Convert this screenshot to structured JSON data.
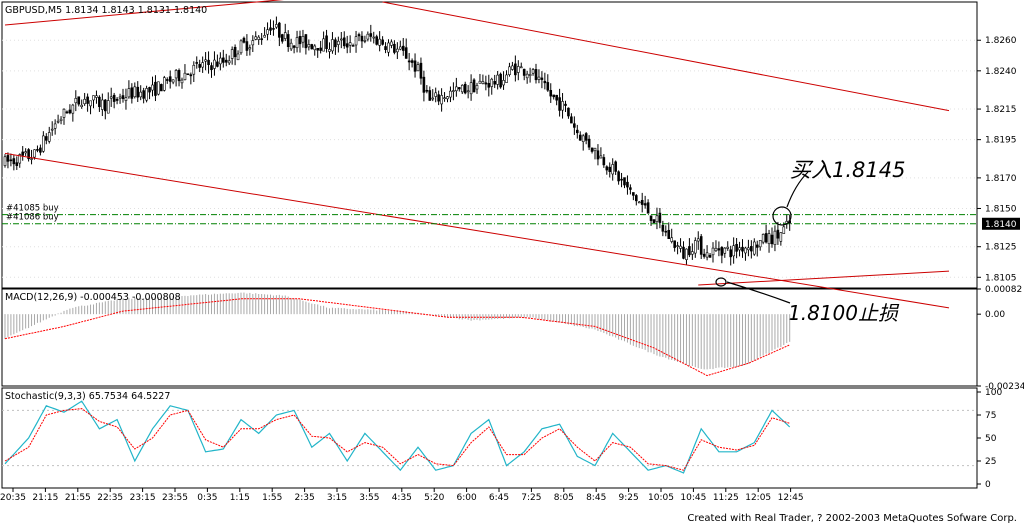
{
  "footer": "Created with Real Trader, ? 2002-2003 MetaQuotes Sofware Corp.",
  "colors": {
    "up_candle": "#ffffff",
    "down_candle": "#000000",
    "trendline": "#cc0000",
    "order_line": "#008000",
    "macd_hist": "#a9a9a9",
    "macd_signal": "#ff0000",
    "stoch_main": "#22b5c9",
    "stoch_signal": "#ff0000",
    "price_box": "#000000"
  },
  "price_pane": {
    "header": "GBPUSD,M5  1.8134 1.8143 1.8131 1.8140",
    "y_ticks": [
      "1.8260",
      "1.8240",
      "1.8215",
      "1.8195",
      "1.8170",
      "1.8150",
      "1.8125",
      "1.8105"
    ],
    "current_price": "1.8140",
    "orders": [
      "#41085 buy",
      "#41086 buy"
    ],
    "annotations": {
      "entry": "买入1.8145",
      "stop": "1.8100止损"
    }
  },
  "macd_pane": {
    "header": "MACD(12,26,9)  -0.000453  -0.000808",
    "y_ticks": [
      "0.00082",
      "0.00",
      "-0.00234"
    ]
  },
  "stoch_pane": {
    "header": "Stochastic(9,3,3)  65.7534  64.5227",
    "y_ticks": [
      "100",
      "75",
      "50",
      "25",
      "0"
    ]
  },
  "x_axis": {
    "labels": [
      "20:35",
      "21:15",
      "21:55",
      "22:35",
      "23:15",
      "23:55",
      "0:35",
      "1:15",
      "1:55",
      "2:35",
      "3:15",
      "3:55",
      "4:35",
      "5:20",
      "6:00",
      "6:45",
      "7:25",
      "8:05",
      "8:45",
      "9:25",
      "10:05",
      "10:45",
      "11:25",
      "12:05",
      "12:45"
    ]
  },
  "chart_data": {
    "type": "candlestick",
    "symbol": "GBPUSD",
    "timeframe": "M5",
    "ohlc_last": {
      "open": 1.8134,
      "high": 1.8143,
      "low": 1.8131,
      "close": 1.814
    },
    "price_range": [
      1.8098,
      1.8285
    ],
    "close_path": [
      [
        0,
        1.818
      ],
      [
        10,
        1.8185
      ],
      [
        18,
        1.8208
      ],
      [
        26,
        1.8222
      ],
      [
        34,
        1.8218
      ],
      [
        42,
        1.8225
      ],
      [
        50,
        1.8227
      ],
      [
        58,
        1.8236
      ],
      [
        66,
        1.8243
      ],
      [
        74,
        1.8246
      ],
      [
        80,
        1.8256
      ],
      [
        86,
        1.8261
      ],
      [
        90,
        1.827
      ],
      [
        96,
        1.826
      ],
      [
        102,
        1.8258
      ],
      [
        110,
        1.8257
      ],
      [
        118,
        1.8259
      ],
      [
        124,
        1.8262
      ],
      [
        130,
        1.8257
      ],
      [
        136,
        1.825
      ],
      [
        140,
        1.824
      ],
      [
        144,
        1.822
      ],
      [
        150,
        1.8225
      ],
      [
        156,
        1.8228
      ],
      [
        162,
        1.8232
      ],
      [
        168,
        1.8233
      ],
      [
        172,
        1.8242
      ],
      [
        178,
        1.824
      ],
      [
        182,
        1.823
      ],
      [
        186,
        1.8222
      ],
      [
        190,
        1.8215
      ],
      [
        194,
        1.82
      ],
      [
        200,
        1.8188
      ],
      [
        206,
        1.8175
      ],
      [
        212,
        1.816
      ],
      [
        218,
        1.8148
      ],
      [
        224,
        1.8134
      ],
      [
        230,
        1.812
      ],
      [
        234,
        1.8128
      ],
      [
        238,
        1.812
      ],
      [
        242,
        1.8124
      ],
      [
        246,
        1.8122
      ],
      [
        250,
        1.8125
      ],
      [
        254,
        1.8126
      ],
      [
        258,
        1.813
      ],
      [
        262,
        1.8132
      ],
      [
        266,
        1.814
      ]
    ],
    "trendlines": [
      {
        "from": [
          0,
          1.827
        ],
        "to": [
          108,
          1.8289
        ]
      },
      {
        "from": [
          0,
          1.8186
        ],
        "to": [
          320,
          1.8085
        ]
      },
      {
        "from": [
          128,
          1.8285
        ],
        "to": [
          320,
          1.8214
        ]
      },
      {
        "from": [
          235,
          1.81
        ],
        "to": [
          320,
          1.8109
        ]
      }
    ],
    "horizontal_lines": [
      1.8146,
      1.814
    ],
    "macd": {
      "ylim": [
        -0.00234,
        0.00082
      ],
      "histogram_path": [
        [
          0,
          -0.0008
        ],
        [
          22,
          0.0002
        ],
        [
          40,
          0.0005
        ],
        [
          60,
          0.0006
        ],
        [
          80,
          0.0007
        ],
        [
          95,
          0.0006
        ],
        [
          110,
          0.0002
        ],
        [
          135,
          0.0001
        ],
        [
          158,
          -0.0002
        ],
        [
          178,
          -0.0001
        ],
        [
          200,
          -0.0005
        ],
        [
          220,
          -0.0013
        ],
        [
          236,
          -0.0018
        ],
        [
          250,
          -0.0017
        ],
        [
          266,
          -0.0009
        ]
      ],
      "signal_path": [
        [
          0,
          -0.0008
        ],
        [
          20,
          -0.0004
        ],
        [
          40,
          0.0001
        ],
        [
          60,
          0.0003
        ],
        [
          80,
          0.0005
        ],
        [
          100,
          0.0005
        ],
        [
          125,
          0.0002
        ],
        [
          150,
          -0.0001
        ],
        [
          175,
          -0.0001
        ],
        [
          200,
          -0.0004
        ],
        [
          220,
          -0.0011
        ],
        [
          238,
          -0.002
        ],
        [
          252,
          -0.0016
        ],
        [
          266,
          -0.001
        ]
      ]
    },
    "stochastic": {
      "ylim": [
        0,
        100
      ],
      "main_path": [
        [
          0,
          22
        ],
        [
          8,
          50
        ],
        [
          14,
          85
        ],
        [
          20,
          78
        ],
        [
          26,
          90
        ],
        [
          32,
          60
        ],
        [
          38,
          70
        ],
        [
          44,
          25
        ],
        [
          50,
          60
        ],
        [
          56,
          85
        ],
        [
          62,
          80
        ],
        [
          68,
          35
        ],
        [
          74,
          38
        ],
        [
          80,
          70
        ],
        [
          86,
          55
        ],
        [
          92,
          75
        ],
        [
          98,
          80
        ],
        [
          104,
          40
        ],
        [
          110,
          55
        ],
        [
          116,
          25
        ],
        [
          122,
          55
        ],
        [
          128,
          35
        ],
        [
          134,
          15
        ],
        [
          140,
          40
        ],
        [
          146,
          15
        ],
        [
          152,
          20
        ],
        [
          158,
          55
        ],
        [
          164,
          70
        ],
        [
          170,
          20
        ],
        [
          176,
          35
        ],
        [
          182,
          60
        ],
        [
          188,
          65
        ],
        [
          194,
          30
        ],
        [
          200,
          20
        ],
        [
          206,
          55
        ],
        [
          212,
          35
        ],
        [
          218,
          15
        ],
        [
          224,
          20
        ],
        [
          230,
          12
        ],
        [
          236,
          60
        ],
        [
          242,
          35
        ],
        [
          248,
          35
        ],
        [
          254,
          45
        ],
        [
          260,
          80
        ],
        [
          266,
          62
        ]
      ],
      "signal_path": [
        [
          0,
          25
        ],
        [
          8,
          40
        ],
        [
          14,
          75
        ],
        [
          20,
          80
        ],
        [
          26,
          82
        ],
        [
          32,
          68
        ],
        [
          38,
          62
        ],
        [
          44,
          38
        ],
        [
          50,
          50
        ],
        [
          56,
          75
        ],
        [
          62,
          80
        ],
        [
          68,
          48
        ],
        [
          74,
          40
        ],
        [
          80,
          60
        ],
        [
          86,
          60
        ],
        [
          92,
          70
        ],
        [
          98,
          75
        ],
        [
          104,
          52
        ],
        [
          110,
          50
        ],
        [
          116,
          35
        ],
        [
          122,
          45
        ],
        [
          128,
          40
        ],
        [
          134,
          22
        ],
        [
          140,
          32
        ],
        [
          146,
          22
        ],
        [
          152,
          20
        ],
        [
          158,
          45
        ],
        [
          164,
          62
        ],
        [
          170,
          32
        ],
        [
          176,
          32
        ],
        [
          182,
          50
        ],
        [
          188,
          60
        ],
        [
          194,
          40
        ],
        [
          200,
          25
        ],
        [
          206,
          45
        ],
        [
          212,
          40
        ],
        [
          218,
          22
        ],
        [
          224,
          20
        ],
        [
          230,
          15
        ],
        [
          236,
          48
        ],
        [
          242,
          40
        ],
        [
          248,
          37
        ],
        [
          254,
          42
        ],
        [
          260,
          72
        ],
        [
          266,
          66
        ]
      ],
      "levels": [
        80,
        20
      ]
    }
  }
}
